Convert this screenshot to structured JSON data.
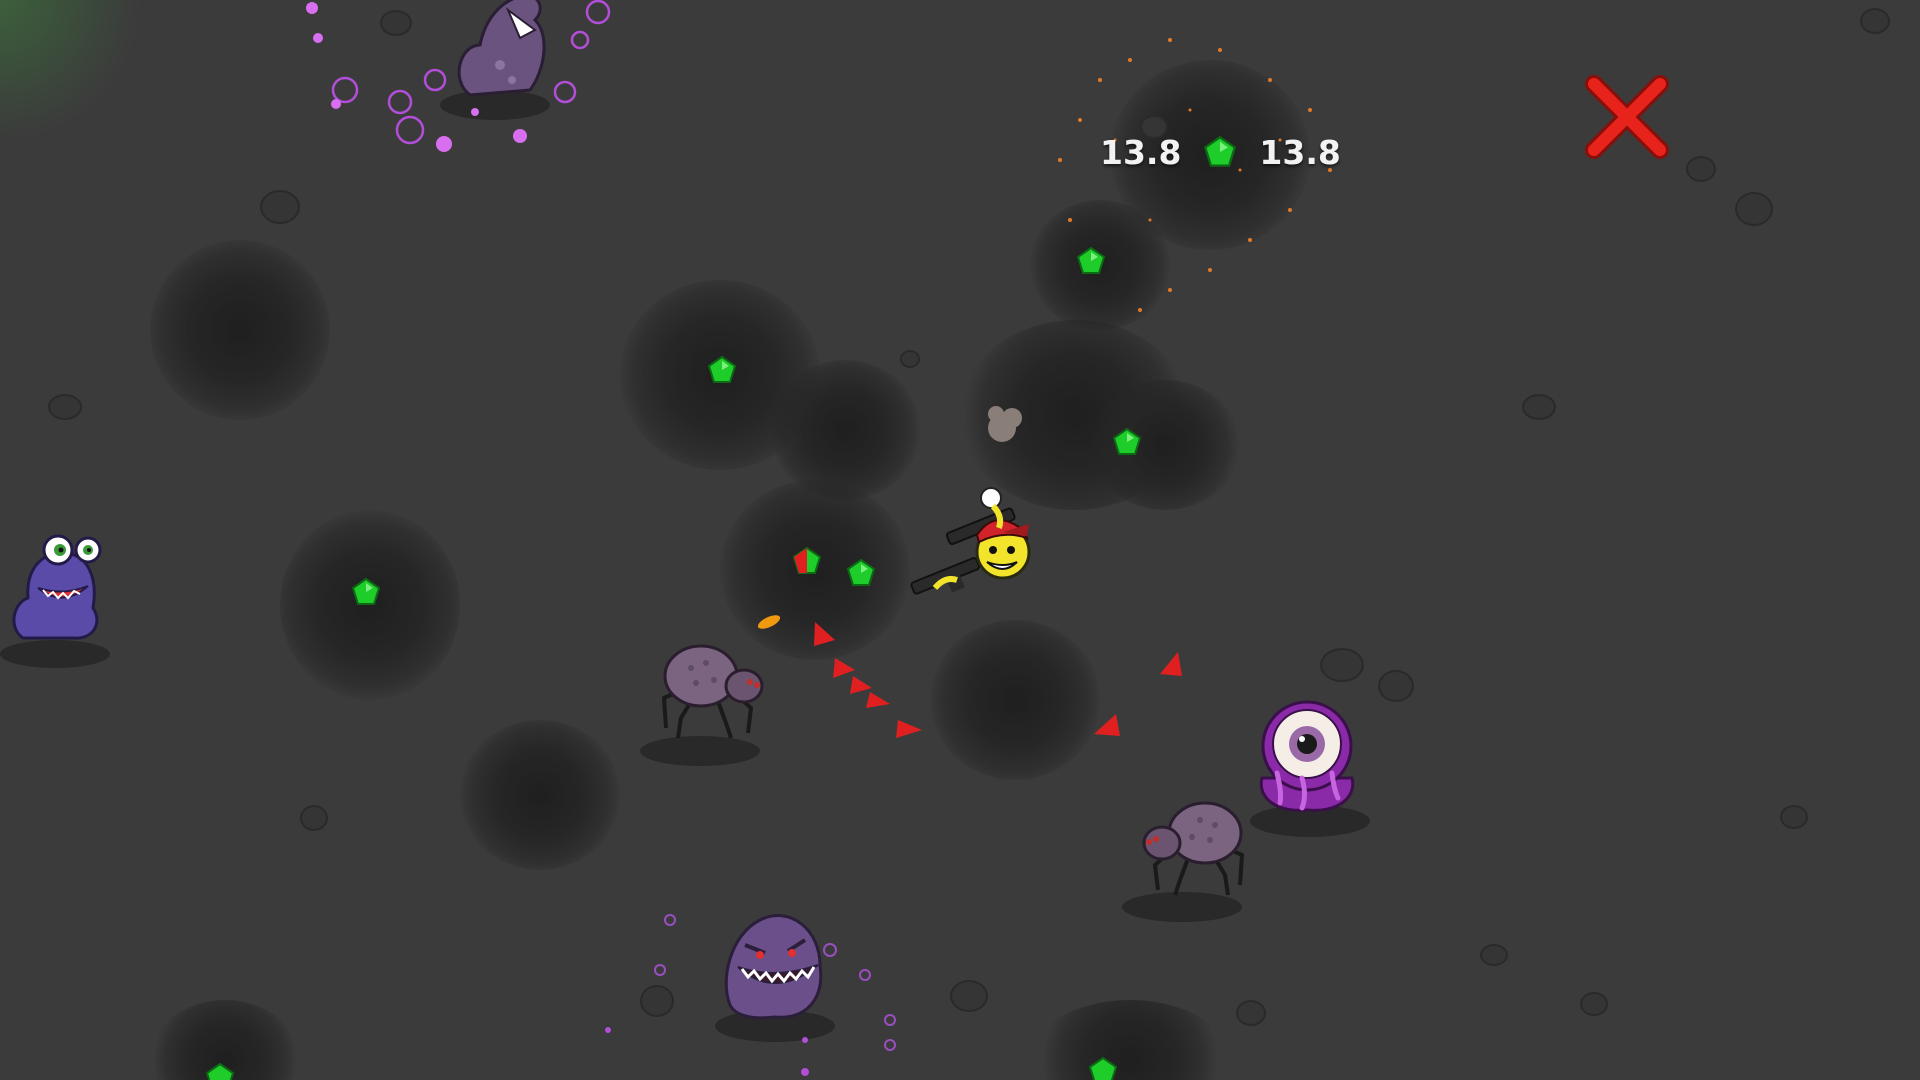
{
  "hud": {
    "gem_left_value": "13.8",
    "gem_right_value": "13.8",
    "gem_icon": "green-pentagon-gem"
  },
  "controls": {
    "close_icon": "close-icon",
    "close_color": "#e8231c"
  },
  "colors": {
    "gem": "#1ecc2a",
    "ground": "#3b3b3b",
    "arrow": "#e02020",
    "player": "#f2e42a"
  }
}
